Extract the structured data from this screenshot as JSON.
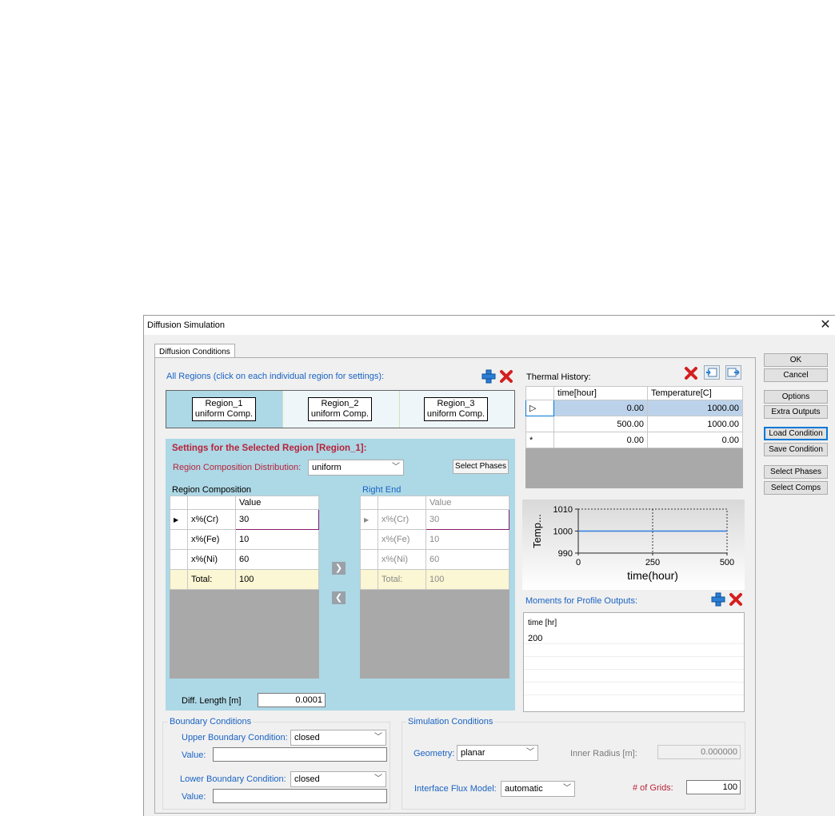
{
  "window": {
    "title": "Diffusion Simulation",
    "close_glyph": "✕"
  },
  "tab": {
    "label": "Diffusion Conditions"
  },
  "regions": {
    "header": "All Regions (click on each individual region for settings):",
    "items": [
      {
        "name": "Region_1",
        "comp": "uniform Comp."
      },
      {
        "name": "Region_2",
        "comp": "uniform Comp."
      },
      {
        "name": "Region_3",
        "comp": "uniform Comp."
      }
    ]
  },
  "selected": {
    "title": "Settings for the Selected Region [Region_1]:",
    "dist_label": "Region Composition Distribution:",
    "dist_value": "uniform",
    "select_phases": "Select Phases",
    "comp_label": "Region Composition",
    "right_label": "Right End",
    "value_header": "Value",
    "rows": [
      {
        "label": "x%(Cr)",
        "value": "30"
      },
      {
        "label": "x%(Fe)",
        "value": "10"
      },
      {
        "label": "x%(Ni)",
        "value": "60"
      }
    ],
    "total_label": "Total:",
    "total_value": "100",
    "right_rows": [
      {
        "label": "x%(Cr)",
        "value": "30"
      },
      {
        "label": "x%(Fe)",
        "value": "10"
      },
      {
        "label": "x%(Ni)",
        "value": "60"
      }
    ],
    "right_total_label": "Total:",
    "right_total_value": "100",
    "diff_label": "Diff. Length [m]",
    "diff_value": "0.0001"
  },
  "thermal": {
    "label": "Thermal History:",
    "headers": [
      "time[hour]",
      "Temperature[C]"
    ],
    "rows": [
      {
        "marker": "▷",
        "time": "0.00",
        "temp": "1000.00"
      },
      {
        "marker": "",
        "time": "500.00",
        "temp": "1000.00"
      },
      {
        "marker": "*",
        "time": "0.00",
        "temp": "0.00"
      }
    ]
  },
  "chart_data": {
    "type": "line",
    "x": [
      0,
      500
    ],
    "series": [
      {
        "values": [
          1000,
          1000
        ]
      }
    ],
    "xlabel": "time(hour)",
    "ylabel": "Temp...",
    "xlim": [
      0,
      500
    ],
    "ylim": [
      990,
      1010
    ],
    "xticks": [
      "0",
      "250",
      "500"
    ],
    "yticks": [
      "1010",
      "1000",
      "990"
    ],
    "grid": "dashed"
  },
  "moments": {
    "label": "Moments for Profile Outputs:",
    "header": "time [hr]",
    "values": [
      "200"
    ]
  },
  "boundary": {
    "title": "Boundary Conditions",
    "upper_label": "Upper Boundary Condition:",
    "upper_value": "closed",
    "value_label": "Value:",
    "lower_label": "Lower Boundary Condition:",
    "lower_value": "closed",
    "value_label2": "Value:"
  },
  "simulation": {
    "title": "Simulation Conditions",
    "geometry_label": "Geometry:",
    "geometry_value": "planar",
    "inner_radius_label": "Inner Radius [m]:",
    "inner_radius_value": "0.000000",
    "flux_label": "Interface Flux Model:",
    "flux_value": "automatic",
    "grids_label": "# of Grids:",
    "grids_value": "100"
  },
  "buttons": {
    "ok": "OK",
    "cancel": "Cancel",
    "options": "Options",
    "extra_outputs": "Extra Outputs",
    "load_condition": "Load Condition",
    "save_condition": "Save Condition",
    "select_phases": "Select Phases",
    "select_comps": "Select Comps"
  },
  "colors": {
    "accent_blue": "#1a63c3",
    "region_panel": "#add8e6",
    "delete_red": "#d41f1f",
    "add_blue": "#2a7fd4"
  }
}
